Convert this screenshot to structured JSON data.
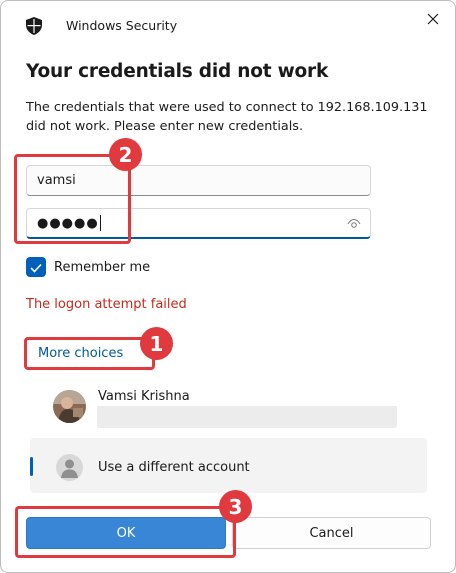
{
  "window": {
    "app_title": "Windows Security",
    "close_icon": "close-icon"
  },
  "dialog": {
    "heading": "Your credentials did not work",
    "description": "The credentials that were used to connect to 192.168.109.131 did not work. Please enter new credentials."
  },
  "form": {
    "username_value": "vamsi",
    "password_dots": "●●●●●",
    "remember_label": "Remember me",
    "remember_checked": true,
    "error_text": "The logon attempt failed"
  },
  "choices": {
    "more_choices_label": "More choices",
    "accounts": [
      {
        "name": "Vamsi Krishna"
      },
      {
        "name": "Use a different account"
      }
    ]
  },
  "buttons": {
    "ok": "OK",
    "cancel": "Cancel"
  },
  "annotations": {
    "badge_1": "1",
    "badge_2": "2",
    "badge_3": "3",
    "color": "#e0393e"
  },
  "colors": {
    "accent": "#005fb8",
    "error": "#c42b1c",
    "primary_button": "#3a86d6"
  }
}
